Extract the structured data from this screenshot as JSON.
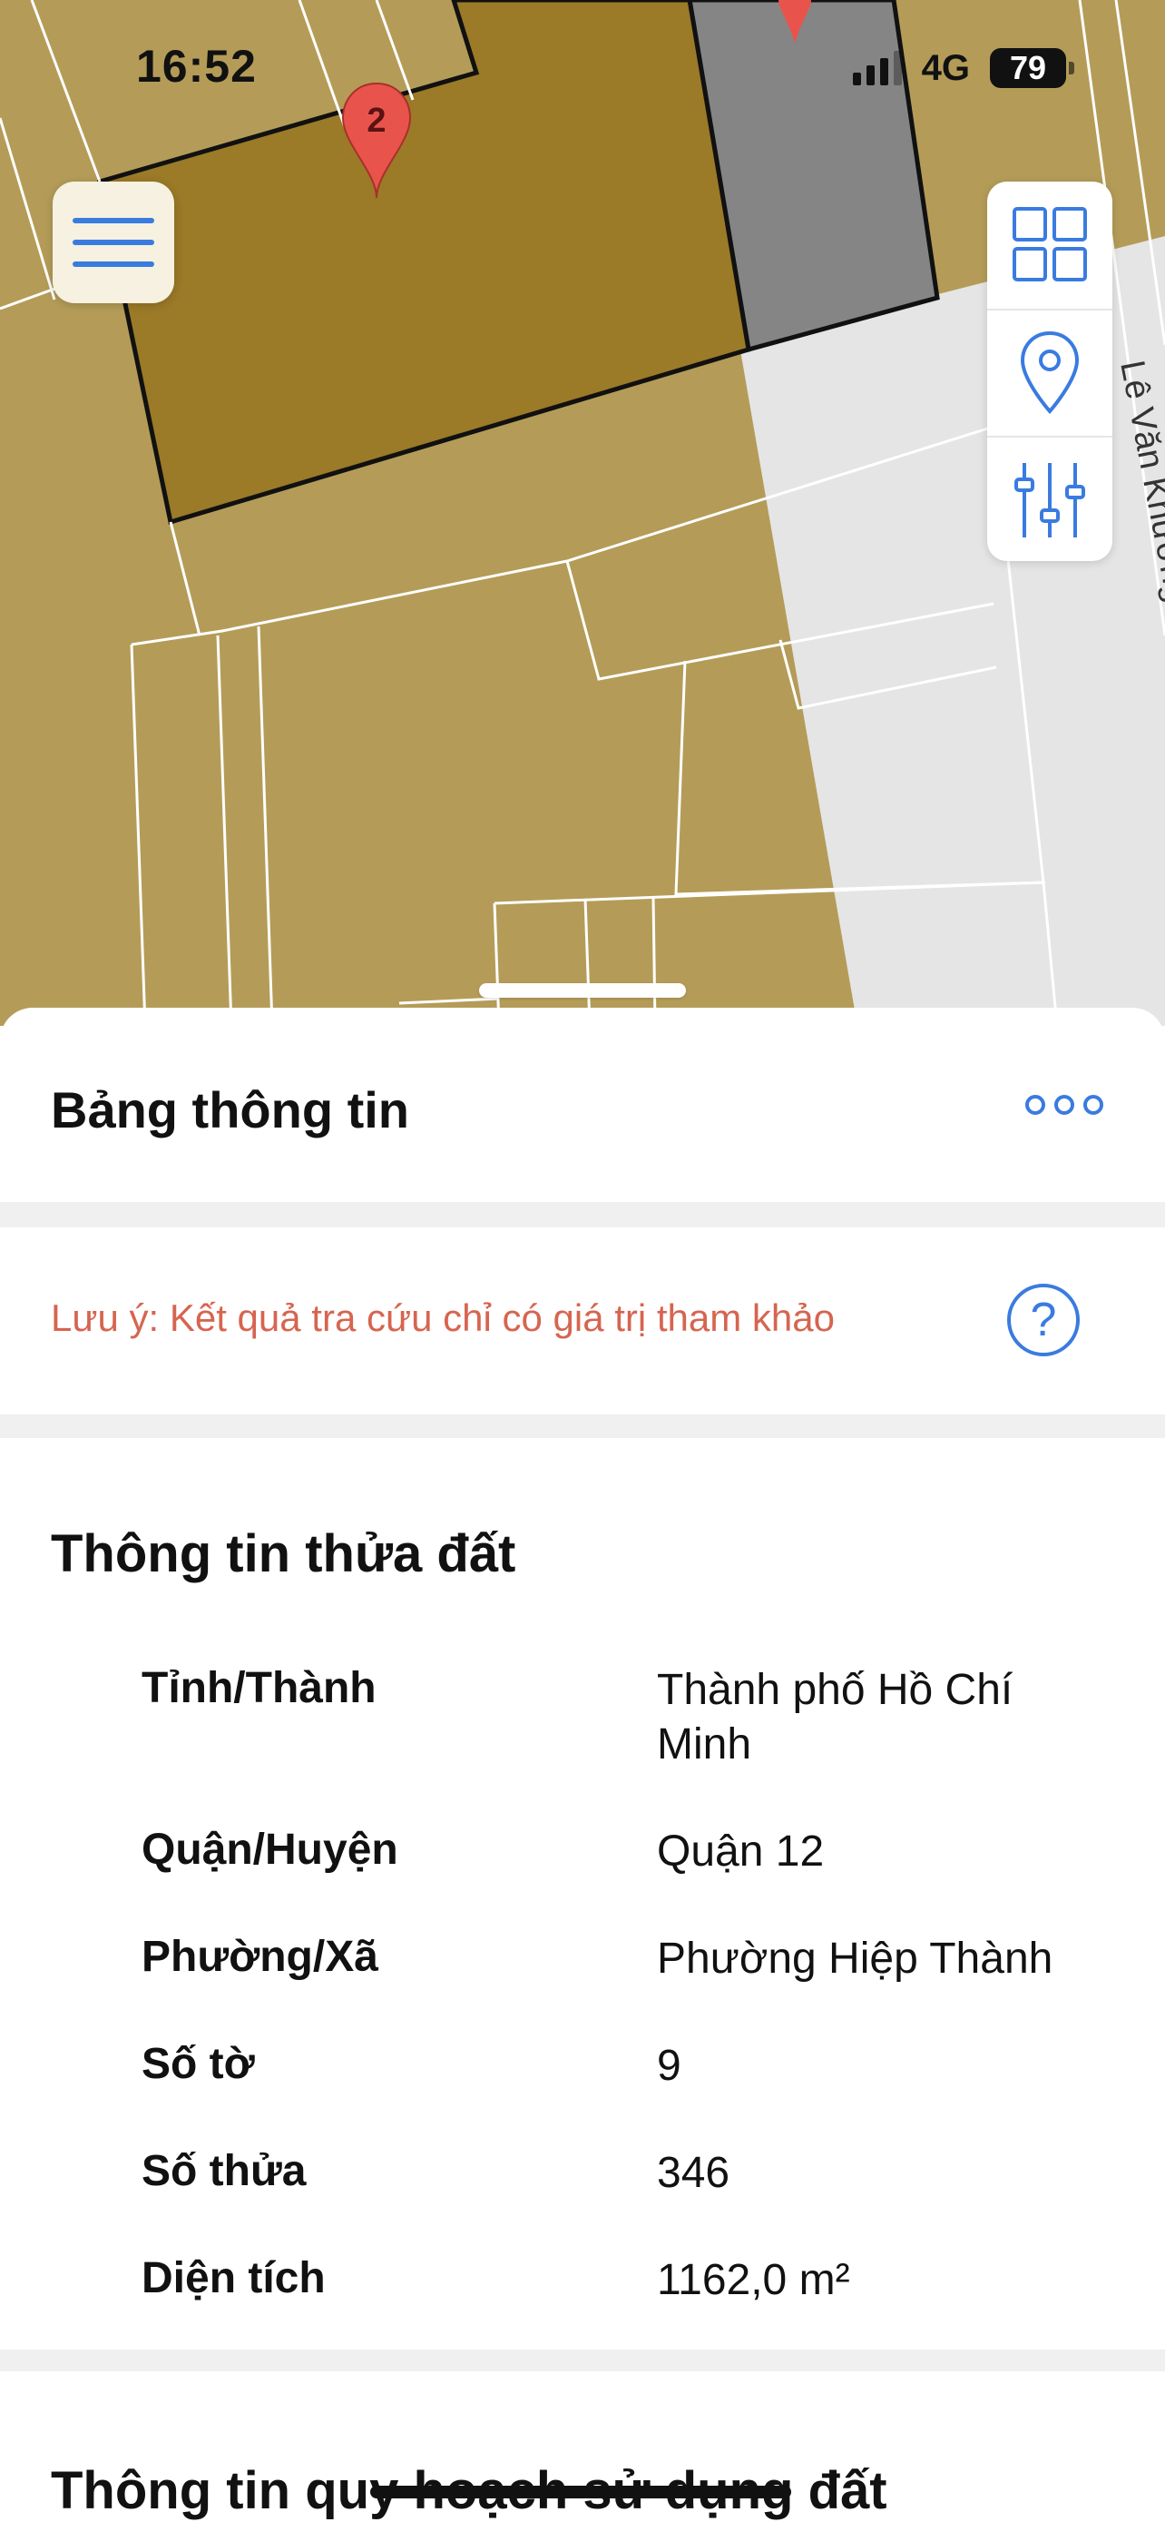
{
  "status_bar": {
    "time": "16:52",
    "network": "4G",
    "battery": "79"
  },
  "map": {
    "street_label": "Lê Văn Khương",
    "marker_label": "2",
    "colors": {
      "land": "#b49c58",
      "parcel_selected": "#9b7a28",
      "parcel_gray": "#858585",
      "road": "#e5e5e5"
    }
  },
  "sheet": {
    "title": "Bảng thông tin",
    "note": "Lưu ý: Kết quả tra cứu chỉ có giá trị tham khảo",
    "help_symbol": "?",
    "section_title": "Thông tin thửa đất",
    "rows": [
      {
        "label": "Tỉnh/Thành",
        "value": "Thành phố Hồ Chí Minh"
      },
      {
        "label": "Quận/Huyện",
        "value": "Quận 12"
      },
      {
        "label": "Phường/Xã",
        "value": "Phường Hiệp Thành"
      },
      {
        "label": "Số tờ",
        "value": "9"
      },
      {
        "label": "Số thửa",
        "value": "346"
      },
      {
        "label": "Diện tích",
        "value": "1162,0 m²"
      }
    ],
    "section2_title": "Thông tin quy hoạch sử dụng đất"
  }
}
